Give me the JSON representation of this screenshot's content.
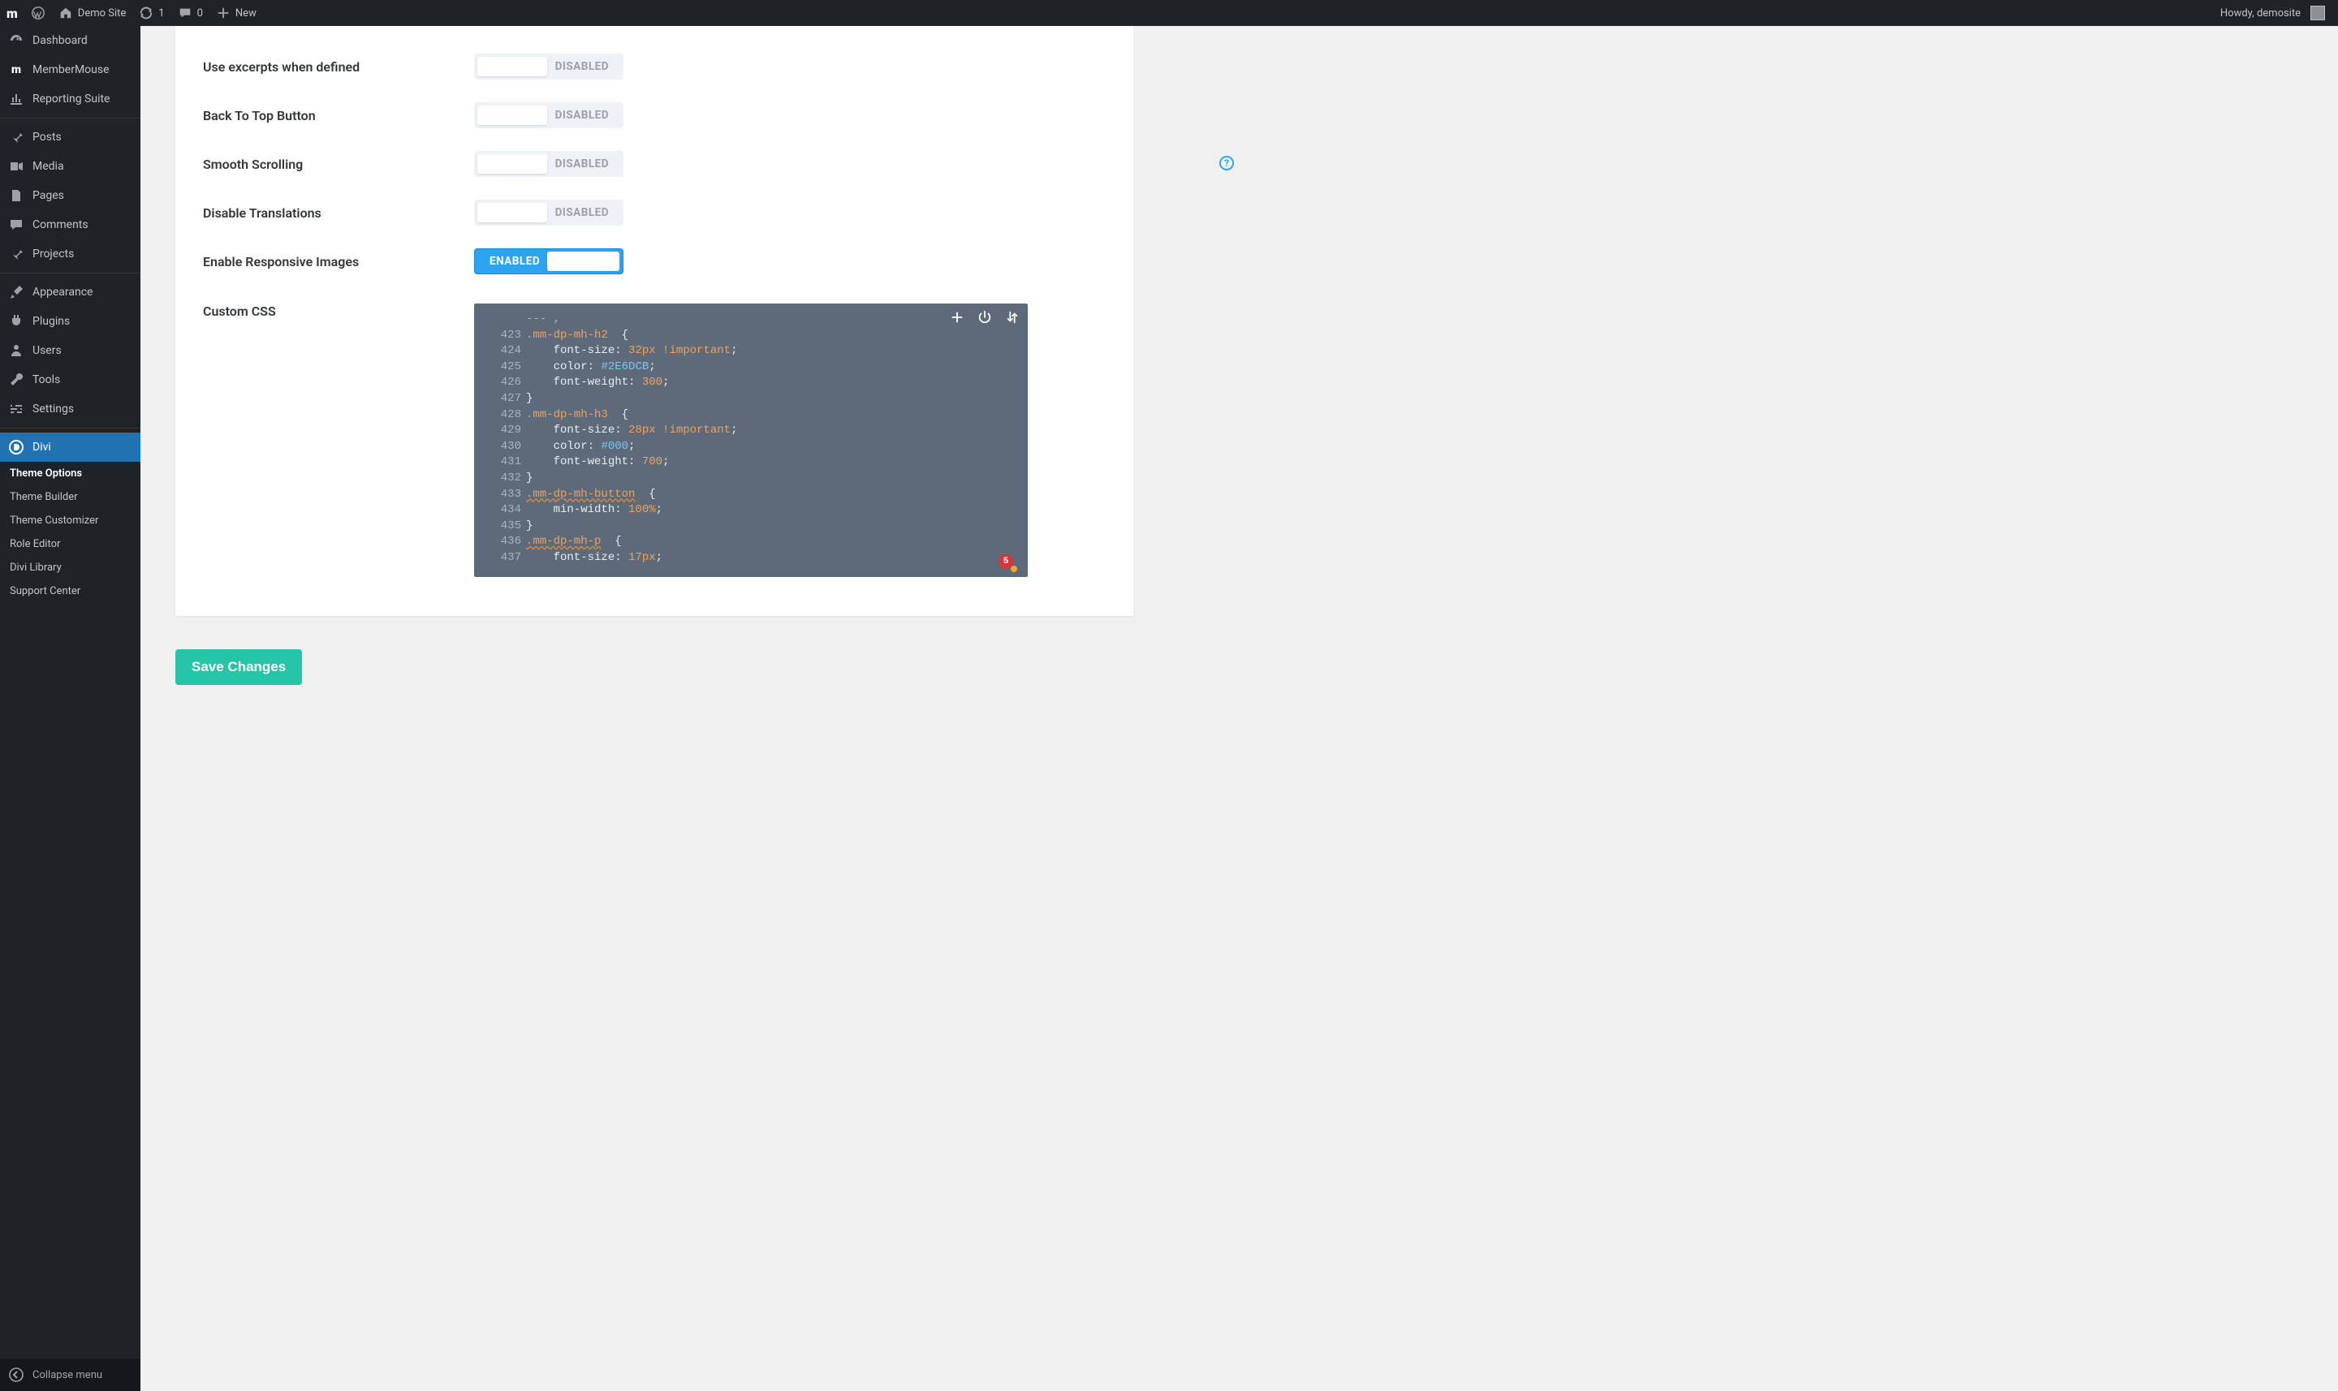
{
  "adminbar": {
    "site_name": "Demo Site",
    "updates_count": "1",
    "comments_count": "0",
    "new_label": "New",
    "howdy_prefix": "Howdy, ",
    "username": "demosite"
  },
  "sidebar": {
    "items": [
      {
        "label": "Dashboard"
      },
      {
        "label": "MemberMouse"
      },
      {
        "label": "Reporting Suite"
      },
      {
        "label": "Posts"
      },
      {
        "label": "Media"
      },
      {
        "label": "Pages"
      },
      {
        "label": "Comments"
      },
      {
        "label": "Projects"
      },
      {
        "label": "Appearance"
      },
      {
        "label": "Plugins"
      },
      {
        "label": "Users"
      },
      {
        "label": "Tools"
      },
      {
        "label": "Settings"
      },
      {
        "label": "Divi"
      }
    ],
    "submenu": [
      {
        "label": "Theme Options",
        "active": true
      },
      {
        "label": "Theme Builder"
      },
      {
        "label": "Theme Customizer"
      },
      {
        "label": "Role Editor"
      },
      {
        "label": "Divi Library"
      },
      {
        "label": "Support Center"
      }
    ],
    "collapse_label": "Collapse menu"
  },
  "settings": {
    "rows": [
      {
        "label": "Use excerpts when defined",
        "state": "off",
        "text": "DISABLED"
      },
      {
        "label": "Back To Top Button",
        "state": "off",
        "text": "DISABLED"
      },
      {
        "label": "Smooth Scrolling",
        "state": "off",
        "text": "DISABLED"
      },
      {
        "label": "Disable Translations",
        "state": "off",
        "text": "DISABLED"
      },
      {
        "label": "Enable Responsive Images",
        "state": "on",
        "text": "ENABLED"
      }
    ],
    "custom_css_label": "Custom CSS",
    "editor_badge": "5",
    "code_lines": [
      {
        "n": "",
        "frag": [
          {
            "c": "dim",
            "t": "--- ,"
          }
        ]
      },
      {
        "n": "423",
        "frag": [
          {
            "c": "sel",
            "t": ".mm-dp-mh-h2"
          },
          {
            "c": "brace",
            "t": "  {"
          }
        ]
      },
      {
        "n": "424",
        "frag": [
          {
            "c": "prop",
            "t": "    font-size"
          },
          {
            "c": "colon",
            "t": ": "
          },
          {
            "c": "val",
            "t": "32px"
          },
          {
            "c": "prop",
            "t": " "
          },
          {
            "c": "imp",
            "t": "!important"
          },
          {
            "c": "semi",
            "t": ";"
          }
        ]
      },
      {
        "n": "425",
        "frag": [
          {
            "c": "prop",
            "t": "    color"
          },
          {
            "c": "colon",
            "t": ": "
          },
          {
            "c": "hex",
            "t": "#2E6DCB"
          },
          {
            "c": "semi",
            "t": ";"
          }
        ]
      },
      {
        "n": "426",
        "frag": [
          {
            "c": "prop",
            "t": "    font-weight"
          },
          {
            "c": "colon",
            "t": ": "
          },
          {
            "c": "val",
            "t": "300"
          },
          {
            "c": "semi",
            "t": ";"
          }
        ]
      },
      {
        "n": "427",
        "frag": [
          {
            "c": "brace",
            "t": "}"
          }
        ]
      },
      {
        "n": "428",
        "frag": [
          {
            "c": "sel",
            "t": ".mm-dp-mh-h3"
          },
          {
            "c": "brace",
            "t": "  {"
          }
        ]
      },
      {
        "n": "429",
        "frag": [
          {
            "c": "prop",
            "t": "    font-size"
          },
          {
            "c": "colon",
            "t": ": "
          },
          {
            "c": "val",
            "t": "28px"
          },
          {
            "c": "prop",
            "t": " "
          },
          {
            "c": "imp",
            "t": "!important"
          },
          {
            "c": "semi",
            "t": ";"
          }
        ]
      },
      {
        "n": "430",
        "frag": [
          {
            "c": "prop",
            "t": "    color"
          },
          {
            "c": "colon",
            "t": ": "
          },
          {
            "c": "hex",
            "t": "#000"
          },
          {
            "c": "semi",
            "t": ";"
          }
        ]
      },
      {
        "n": "431",
        "frag": [
          {
            "c": "prop",
            "t": "    font-weight"
          },
          {
            "c": "colon",
            "t": ": "
          },
          {
            "c": "val",
            "t": "700"
          },
          {
            "c": "semi",
            "t": ";"
          }
        ]
      },
      {
        "n": "432",
        "frag": [
          {
            "c": "brace",
            "t": "}"
          }
        ]
      },
      {
        "n": "433",
        "frag": [
          {
            "c": "selU",
            "t": ".mm-dp-mh-button"
          },
          {
            "c": "brace",
            "t": "  {"
          }
        ]
      },
      {
        "n": "434",
        "frag": [
          {
            "c": "prop",
            "t": "    min-width"
          },
          {
            "c": "colon",
            "t": ": "
          },
          {
            "c": "val",
            "t": "100%"
          },
          {
            "c": "semi",
            "t": ";"
          }
        ]
      },
      {
        "n": "435",
        "frag": [
          {
            "c": "brace",
            "t": "}"
          }
        ]
      },
      {
        "n": "436",
        "frag": [
          {
            "c": "selU",
            "t": ".mm-dp-mh-p"
          },
          {
            "c": "brace",
            "t": "  {"
          }
        ]
      },
      {
        "n": "437",
        "frag": [
          {
            "c": "prop",
            "t": "    font-size"
          },
          {
            "c": "colon",
            "t": ": "
          },
          {
            "c": "val",
            "t": "17px"
          },
          {
            "c": "semi",
            "t": ";"
          }
        ]
      }
    ]
  },
  "buttons": {
    "save_changes": "Save Changes"
  }
}
